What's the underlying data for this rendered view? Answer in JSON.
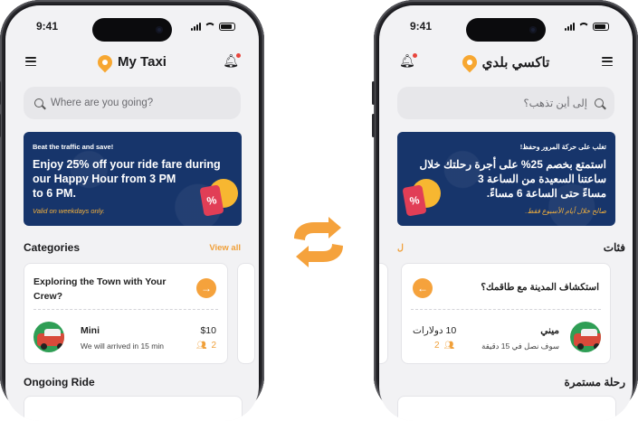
{
  "status": {
    "time": "9:41"
  },
  "left": {
    "app_title": "My Taxi",
    "search_placeholder": "Where are you going?",
    "banner": {
      "kicker": "Beat the traffic and save!",
      "headline_1": "Enjoy 25% off your ride fare during",
      "headline_2": "our Happy Hour from 3 PM",
      "headline_3": "to 6 PM.",
      "note": "Valid on weekdays only.",
      "tag_symbol": "%"
    },
    "categories_title": "Categories",
    "view_all": "View all",
    "card": {
      "question_1": "Exploring the Town with Your",
      "question_2": "Crew?",
      "arrow": "→",
      "car_name": "Mini",
      "eta": "We will arrived in 15 min",
      "price": "$10",
      "seats": "2"
    },
    "ongoing_title": "Ongoing Ride"
  },
  "right": {
    "app_title": "تاكسي بلدي",
    "search_placeholder": "إلى أين تذهب؟",
    "banner": {
      "kicker": "تغلب على حركة المرور وحفظ!",
      "headline_1": "استمتع بخصم 25% على أجرة رحلتك خلال",
      "headline_2": "ساعتنا السعيدة من الساعة 3",
      "headline_3": "مساءً حتى الساعة 6 مساءً.",
      "note": "صالح خلال أيام الأسبوع فقط.",
      "tag_symbol": "%"
    },
    "categories_title": "فئات",
    "view_all": "ل",
    "card": {
      "question": "استكشاف المدينة مع طاقمك؟",
      "arrow": "←",
      "car_name": "ميني",
      "eta": "سوف نصل في 15 دقيقة",
      "price": "10 دولارات",
      "seats": "2"
    },
    "ongoing_title": "رحلة مستمرة"
  },
  "colors": {
    "accent": "#f5a23c",
    "banner": "#17356b",
    "swap": "#f5a23c"
  },
  "icons": [
    "hamburger-icon",
    "bell-icon",
    "pin-logo-icon",
    "search-icon",
    "arrow-icon",
    "people-icon",
    "swap-icon",
    "signal-icon",
    "wifi-icon",
    "battery-icon"
  ]
}
